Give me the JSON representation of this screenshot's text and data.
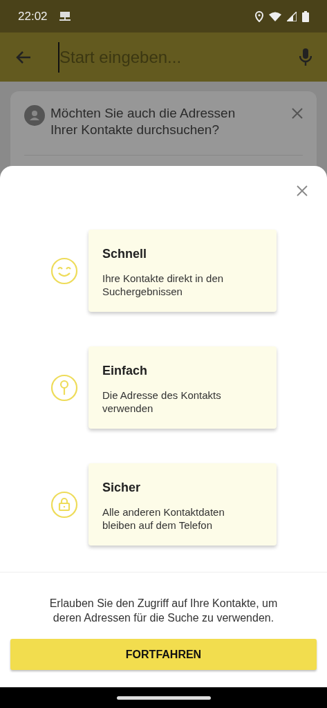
{
  "status_bar": {
    "time": "22:02"
  },
  "search": {
    "placeholder": "Start eingeben..."
  },
  "prompt_card": {
    "text": "Möchten Sie auch die Adressen Ihrer Kontakte durchsuchen?"
  },
  "sheet": {
    "features": [
      {
        "kind": "smile",
        "title": "Schnell",
        "text": "Ihre Kontakte direkt in den Suchergebnissen"
      },
      {
        "kind": "pin",
        "title": "Einfach",
        "text": "Die Adresse des Kontakts verwenden"
      },
      {
        "kind": "lock",
        "title": "Sicher",
        "text": "Alle anderen Kontaktdaten bleiben auf dem Telefon"
      }
    ],
    "message": "Erlauben Sie den Zugriff auf Ihre Kontakte, um deren Adressen für die Suche zu verwenden.",
    "button": "FORTFAHREN"
  }
}
